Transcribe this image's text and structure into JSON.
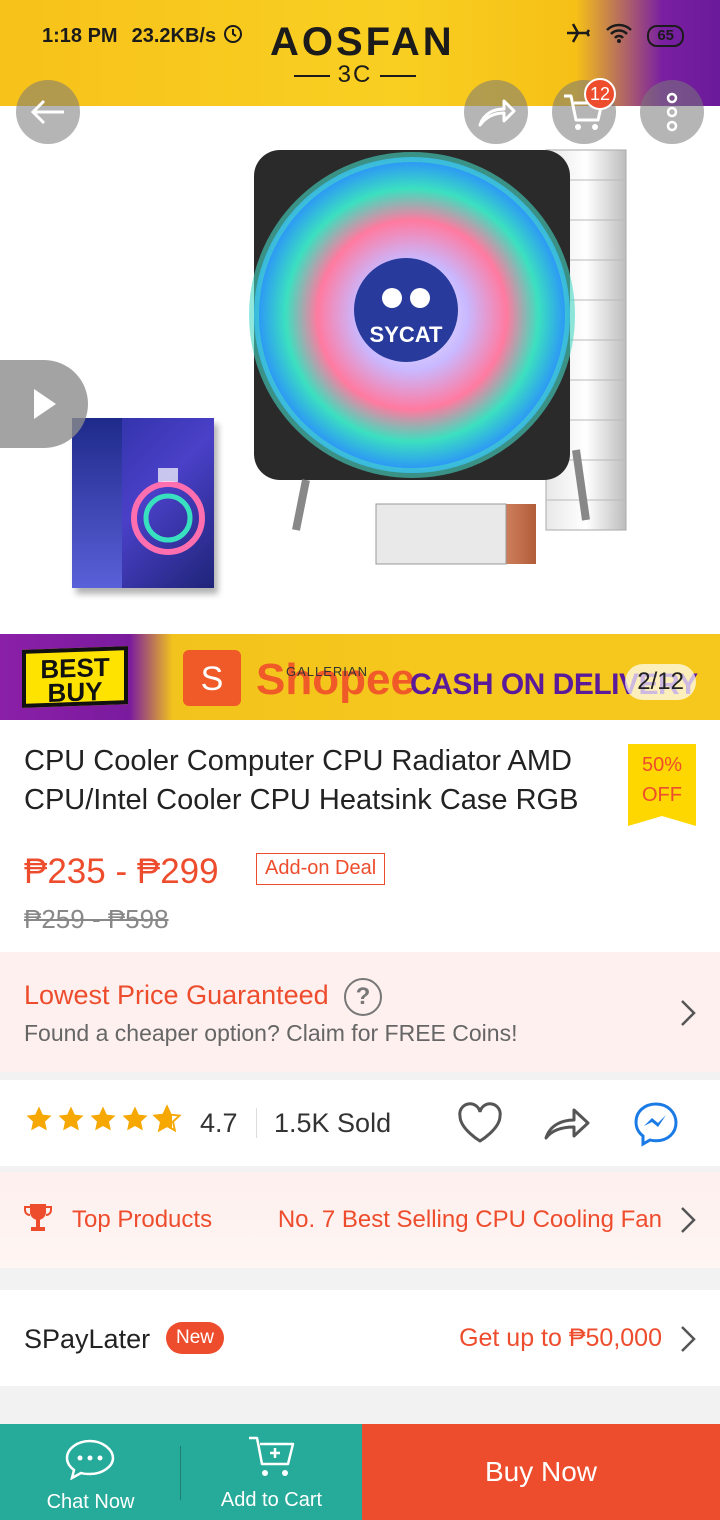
{
  "status_bar": {
    "time": "1:18 PM",
    "network_speed": "23.2KB/s",
    "battery": "65"
  },
  "brand": {
    "name": "AOSFAN",
    "sub": "3C"
  },
  "header": {
    "cart_count": "12"
  },
  "gallery": {
    "counter": "2/12",
    "product_logo": "SYCAT",
    "banner": {
      "bestbuy_line1": "BEST",
      "bestbuy_line2": "BUY",
      "shopee_glyph": "S",
      "shopee_word": "Shopee",
      "gallerian": "GALLERIAN",
      "cod": "CASH ON DELIVERY"
    }
  },
  "product": {
    "title": "CPU Cooler Computer CPU Radiator AMD CPU/Intel Cooler CPU Heatsink Case RGB",
    "discount_pct": "50%",
    "discount_word": "OFF",
    "price_range": "₱235 - ₱299",
    "deal_badge": "Add-on Deal",
    "original_price": "₱259 - ₱598"
  },
  "lowest_price": {
    "title": "Lowest Price Guaranteed",
    "help_glyph": "?",
    "description": "Found a cheaper option? Claim for FREE Coins!"
  },
  "rating": {
    "score": "4.7",
    "score_value": 4.7,
    "sold": "1.5K Sold"
  },
  "top_products": {
    "label": "Top Products",
    "rank_text": "No. 7 Best Selling CPU Cooling Fan"
  },
  "spaylater": {
    "label": "SPayLater",
    "badge": "New",
    "offer": "Get up to ₱50,000"
  },
  "bottom_bar": {
    "chat": "Chat Now",
    "add_to_cart": "Add to Cart",
    "buy_now": "Buy Now"
  },
  "colors": {
    "accent": "#ee4d2d",
    "teal": "#26aa99",
    "star": "#f6a700"
  }
}
